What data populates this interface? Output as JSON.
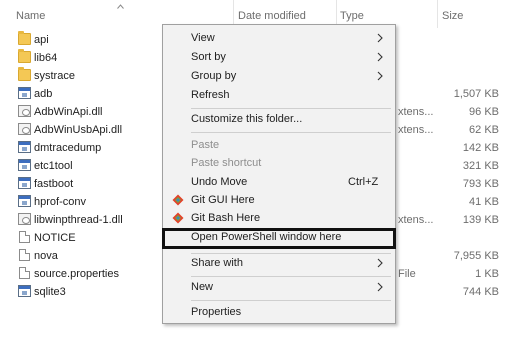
{
  "header": {
    "name": "Name",
    "date_modified": "Date modified",
    "type": "Type",
    "size": "Size"
  },
  "files": [
    {
      "name": "api",
      "icon": "folder-icon",
      "type": "",
      "size": ""
    },
    {
      "name": "lib64",
      "icon": "folder-icon",
      "type": "",
      "size": ""
    },
    {
      "name": "systrace",
      "icon": "folder-icon",
      "type": "",
      "size": ""
    },
    {
      "name": "adb",
      "icon": "application-icon",
      "type": "",
      "size": "1,507 KB"
    },
    {
      "name": "AdbWinApi.dll",
      "icon": "dll-icon",
      "type": "xtens...",
      "size": "96 KB"
    },
    {
      "name": "AdbWinUsbApi.dll",
      "icon": "dll-icon",
      "type": "xtens...",
      "size": "62 KB"
    },
    {
      "name": "dmtracedump",
      "icon": "application-icon",
      "type": "",
      "size": "142 KB"
    },
    {
      "name": "etc1tool",
      "icon": "application-icon",
      "type": "",
      "size": "321 KB"
    },
    {
      "name": "fastboot",
      "icon": "application-icon",
      "type": "",
      "size": "793 KB"
    },
    {
      "name": "hprof-conv",
      "icon": "application-icon",
      "type": "",
      "size": "41 KB"
    },
    {
      "name": "libwinpthread-1.dll",
      "icon": "dll-icon",
      "type": "xtens...",
      "size": "139 KB"
    },
    {
      "name": "NOTICE",
      "icon": "file-icon",
      "type": "",
      "size": ""
    },
    {
      "name": "nova",
      "icon": "file-icon",
      "type": "",
      "size": "7,955 KB"
    },
    {
      "name": "source.properties",
      "icon": "file-icon",
      "type": "File",
      "size": "1 KB"
    },
    {
      "name": "sqlite3",
      "icon": "application-icon",
      "type": "",
      "size": "744 KB"
    }
  ],
  "menu": {
    "view": "View",
    "sort_by": "Sort by",
    "group_by": "Group by",
    "refresh": "Refresh",
    "customize": "Customize this folder...",
    "paste": "Paste",
    "paste_shortcut": "Paste shortcut",
    "undo_move": "Undo Move",
    "undo_shortcut": "Ctrl+Z",
    "git_gui": "Git GUI Here",
    "git_bash": "Git Bash Here",
    "powershell": "Open PowerShell window here",
    "share_with": "Share with",
    "new": "New",
    "properties": "Properties"
  },
  "colors": {
    "menu_bg": "#f2f2f2",
    "highlight_border": "#111111",
    "folder": "#f4c855",
    "disabled_text": "#8e8e8e"
  }
}
